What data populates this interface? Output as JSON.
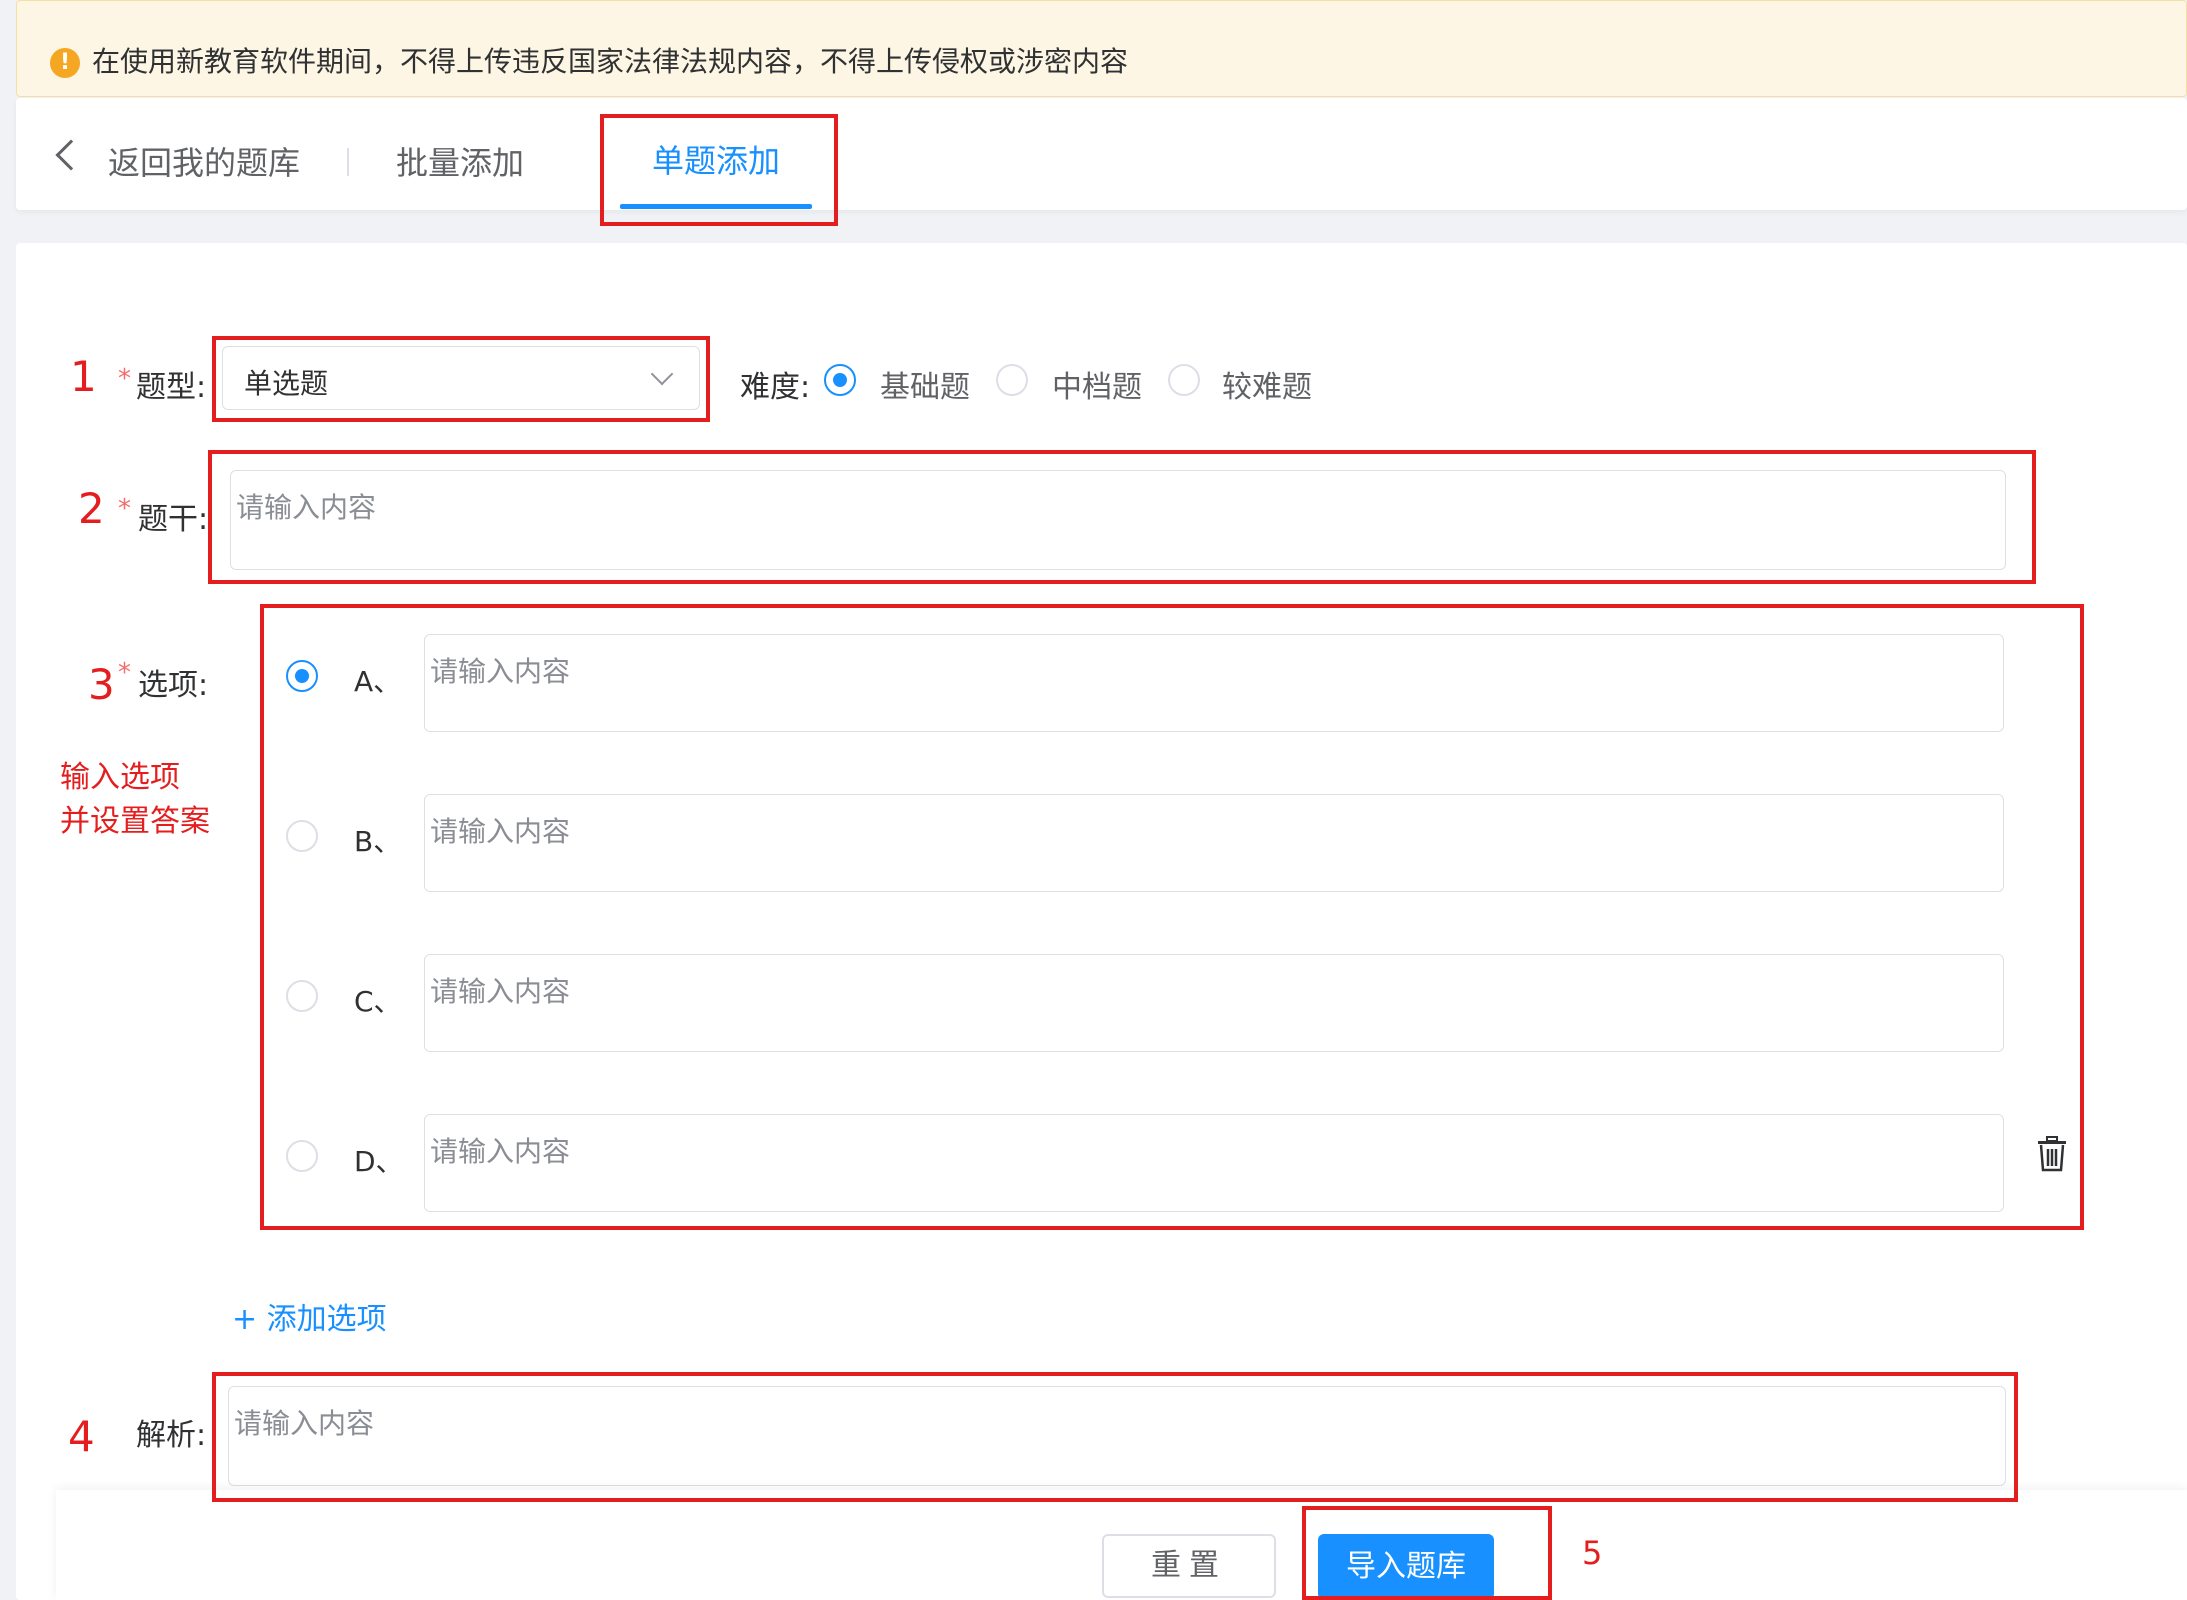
{
  "notice": {
    "text": "在使用新教育软件期间，不得上传违反国家法律法规内容，不得上传侵权或涉密内容",
    "icon": "warning-icon"
  },
  "tabs": {
    "back": "返回我的题库",
    "batch": "批量添加",
    "single": "单题添加"
  },
  "form": {
    "required_mark": "*",
    "type_label": "题型:",
    "type_value": "单选题",
    "difficulty_label": "难度:",
    "difficulty_options": [
      "基础题",
      "中档题",
      "较难题"
    ],
    "difficulty_selected": "基础题",
    "stem_label": "题干:",
    "options_label": "选项:",
    "analysis_label": "解析:",
    "placeholder": "请输入内容",
    "option_letters": [
      "A、",
      "B、",
      "C、",
      "D、"
    ],
    "selected_option": "A、",
    "add_option": "+ 添加选项"
  },
  "annotations": {
    "n1": "1",
    "n2": "2",
    "n3": "3",
    "n4": "4",
    "n5": "5",
    "note_line1": "输入选项",
    "note_line2": "并设置答案"
  },
  "buttons": {
    "reset": "重置",
    "import": "导入题库"
  },
  "colors": {
    "accent": "#1890ff",
    "annotation": "#e41e1e",
    "warning": "#f5a623"
  }
}
